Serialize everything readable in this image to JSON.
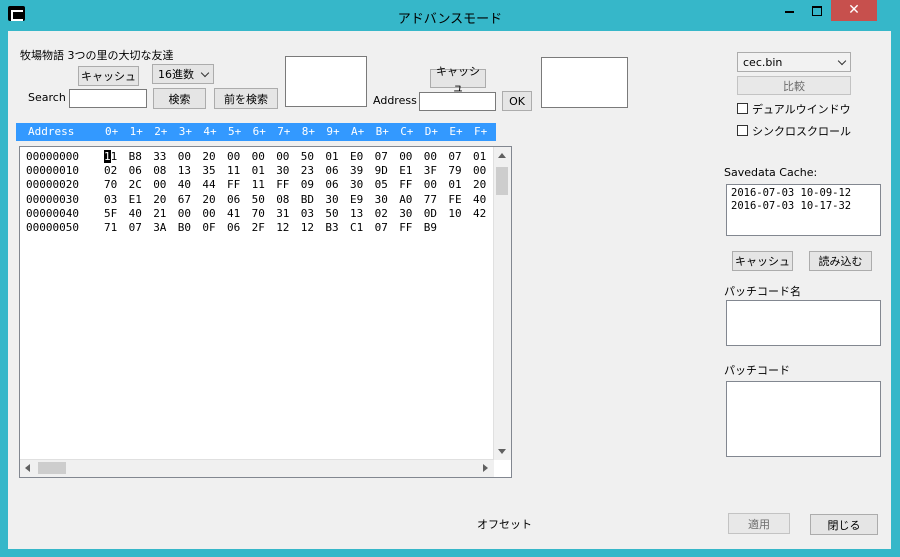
{
  "window": {
    "title": "アドバンスモード",
    "close_glyph": "✕"
  },
  "search_panel": {
    "game_label": "牧場物語 3つの里の大切な友達",
    "cache_button": "キャッシュ",
    "radix_select": "16進数",
    "search_label": "Search",
    "search_input_value": "",
    "search_button": "検索",
    "prev_search_button": "前を検索"
  },
  "address_panel": {
    "cache_button": "キャッシュ",
    "address_label": "Address",
    "address_input_value": "",
    "ok_button": "OK"
  },
  "hex_view": {
    "header_label": "Address",
    "columns": [
      "0+",
      "1+",
      "2+",
      "3+",
      "4+",
      "5+",
      "6+",
      "7+",
      "8+",
      "9+",
      "A+",
      "B+",
      "C+",
      "D+",
      "E+",
      "F+"
    ],
    "rows": [
      {
        "addr": "00000000",
        "bytes": [
          "11",
          "B8",
          "33",
          "00",
          "20",
          "00",
          "00",
          "00",
          "50",
          "01",
          "E0",
          "07",
          "00",
          "00",
          "07",
          "01"
        ]
      },
      {
        "addr": "00000010",
        "bytes": [
          "02",
          "06",
          "08",
          "13",
          "35",
          "11",
          "01",
          "30",
          "23",
          "06",
          "39",
          "9D",
          "E1",
          "3F",
          "79",
          "00"
        ]
      },
      {
        "addr": "00000020",
        "bytes": [
          "70",
          "2C",
          "00",
          "40",
          "44",
          "FF",
          "11",
          "FF",
          "09",
          "06",
          "30",
          "05",
          "FF",
          "00",
          "01",
          "20"
        ]
      },
      {
        "addr": "00000030",
        "bytes": [
          "03",
          "E1",
          "20",
          "67",
          "20",
          "06",
          "50",
          "08",
          "BD",
          "30",
          "E9",
          "30",
          "A0",
          "77",
          "FE",
          "40"
        ]
      },
      {
        "addr": "00000040",
        "bytes": [
          "5F",
          "40",
          "21",
          "00",
          "00",
          "41",
          "70",
          "31",
          "03",
          "50",
          "13",
          "02",
          "30",
          "0D",
          "10",
          "42"
        ]
      },
      {
        "addr": "00000050",
        "bytes": [
          "71",
          "07",
          "3A",
          "B0",
          "0F",
          "06",
          "2F",
          "12",
          "12",
          "B3",
          "C1",
          "07",
          "FF",
          "B9"
        ]
      }
    ]
  },
  "right_panel": {
    "file_select": "cec.bin",
    "compare_button": "比較",
    "dual_window_label": "デュアルウインドウ",
    "dual_window_checked": false,
    "sync_scroll_label": "シンクロスクロール",
    "sync_scroll_checked": false,
    "savedata_cache_label": "Savedata Cache:",
    "cache_entries": [
      "2016-07-03 10-09-12",
      "2016-07-03 10-17-32"
    ],
    "cache_button": "キャッシュ",
    "load_button": "読み込む",
    "patch_name_label": "パッチコード名",
    "patch_code_label": "パッチコード"
  },
  "footer": {
    "offset_label": "オフセット",
    "apply_button": "適用",
    "close_button": "閉じる"
  }
}
